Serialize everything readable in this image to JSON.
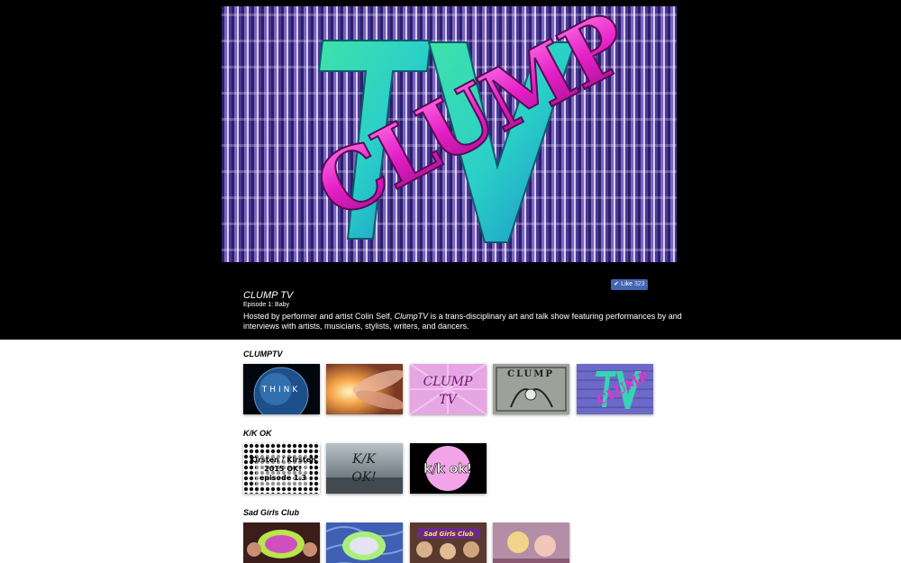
{
  "hero": {
    "logo_text": "CLUMP",
    "logo_tv": "TV"
  },
  "like_button": {
    "label": "Like",
    "count": "323"
  },
  "show": {
    "title": "CLUMP TV",
    "episode": "Episode 1: Baby",
    "description_before": "Hosted by performer and artist Colin Self, ",
    "description_italic": "ClumpTV",
    "description_after": " is a trans-disciplinary art and talk show featuring performances by and interviews with artists, musicians, stylists, writers, and dancers."
  },
  "sections": [
    {
      "title": "CLUMPTV",
      "thumbs": [
        {
          "name": "think-earth",
          "text": "THINK"
        },
        {
          "name": "glowing-hands",
          "text": ""
        },
        {
          "name": "clump-tv-pink",
          "text": "CLUMP TV"
        },
        {
          "name": "clump-silver",
          "text": "CLUMP"
        },
        {
          "name": "clump-tv-logo",
          "text": "CLUMP"
        }
      ]
    },
    {
      "title": "K/K OK",
      "thumbs": [
        {
          "name": "kirsten-kirsten",
          "text": "Kirsten / Kirsten 2015 OK! episode 1.3"
        },
        {
          "name": "kk-ok-script",
          "text": "K/K OK!"
        },
        {
          "name": "kk-ok-pink",
          "text": "k/k ok!"
        }
      ]
    },
    {
      "title": "Sad Girls Club",
      "thumbs": [
        {
          "name": "sad-girls-1",
          "text": ""
        },
        {
          "name": "sad-girls-2",
          "text": ""
        },
        {
          "name": "sad-girls-club-banner",
          "text": "Sad Girls Club"
        },
        {
          "name": "sad-girls-4",
          "text": ""
        }
      ]
    }
  ]
}
